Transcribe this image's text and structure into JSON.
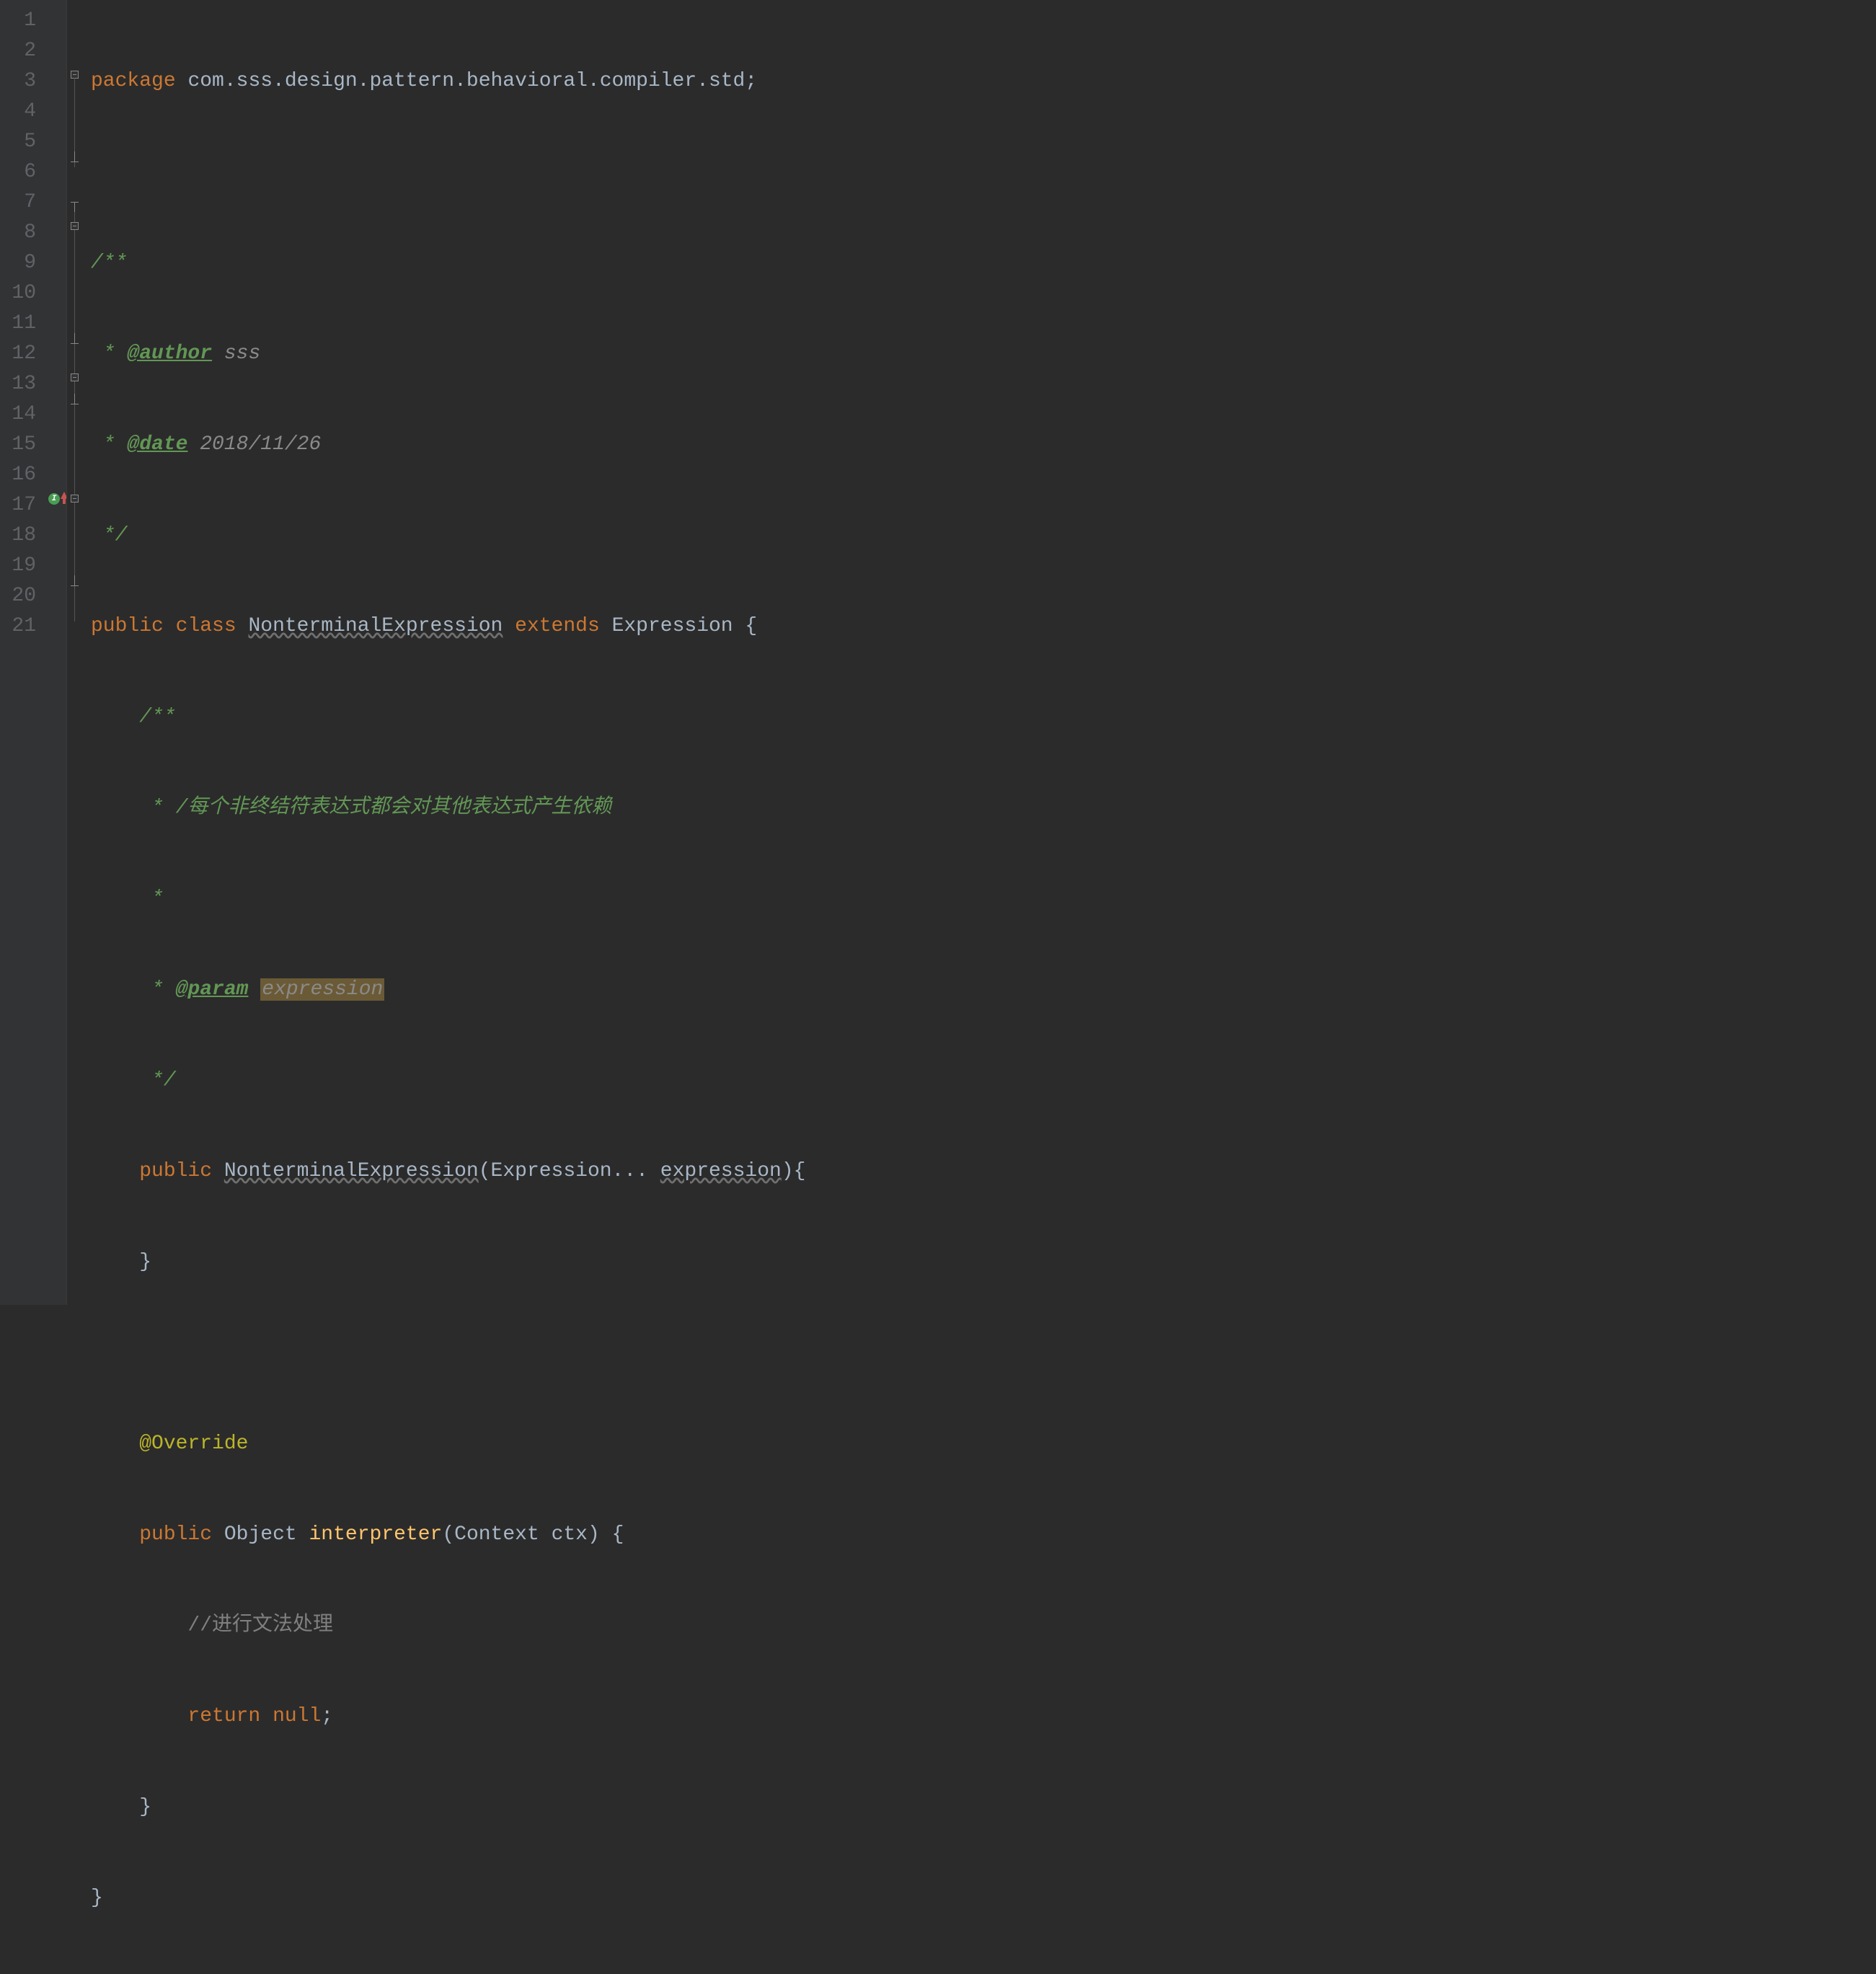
{
  "lines": {
    "l1": "1",
    "l2": "2",
    "l3": "3",
    "l4": "4",
    "l5": "5",
    "l6": "6",
    "l7": "7",
    "l8": "8",
    "l9": "9",
    "l10": "10",
    "l11": "11",
    "l12": "12",
    "l13": "13",
    "l14": "14",
    "l15": "15",
    "l16": "16",
    "l17": "17",
    "l18": "18",
    "l19": "19",
    "l20": "20",
    "l21": "21"
  },
  "code": {
    "kw_package": "package",
    "pkg_name": "com.sss.design.pattern.behavioral.compiler.std",
    "semi": ";",
    "doc_open": "/**",
    "doc_star": " * ",
    "tag_author": "@author",
    "author_val": " sss",
    "tag_date": "@date",
    "date_val": " 2018/11/26",
    "doc_close": " */",
    "kw_public": "public",
    "kw_class": "class",
    "class_name": "NonterminalExpression",
    "kw_extends": "extends",
    "super_name": "Expression",
    "brace_open": " {",
    "inner_doc_open": "/**",
    "inner_doc_line1": " * /每个非终结符表达式都会对其他表达式产生依赖",
    "inner_doc_line2": " *",
    "inner_doc_star": " * ",
    "tag_param": "@param",
    "param_name": "expression",
    "inner_doc_close": " */",
    "ctor_name": "NonterminalExpression",
    "ctor_params_open": "(",
    "ctor_param_type": "Expression...",
    "ctor_param_name": "expression",
    "ctor_params_close": "){",
    "brace_close": "}",
    "anno_override": "@Override",
    "ret_type": "Object",
    "method_name": "interpreter",
    "method_params": "(Context ctx) {",
    "line_comment": "//进行文法处理",
    "kw_return": "return",
    "kw_null": "null",
    "end_brace": "}"
  }
}
